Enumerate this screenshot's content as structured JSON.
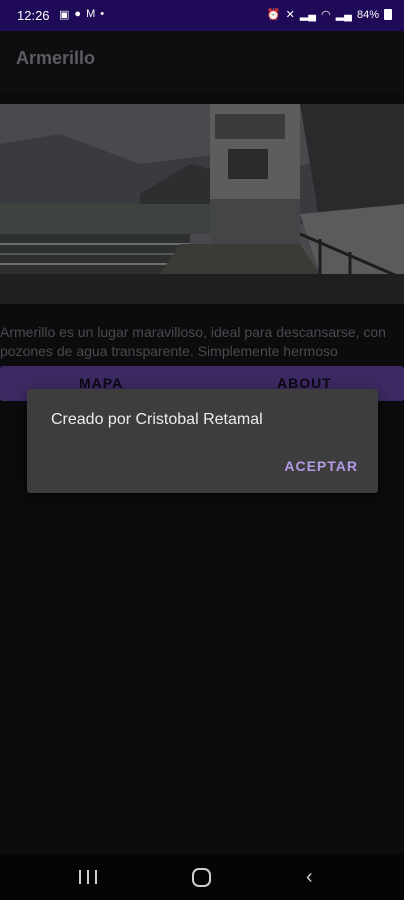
{
  "status_bar": {
    "time": "12:26",
    "left_icons": [
      "gallery-icon",
      "messenger-icon",
      "gmail-icon",
      "dot-icon"
    ],
    "battery": "84%"
  },
  "app_bar": {
    "title": "Armerillo"
  },
  "content": {
    "description": "Armerillo es un lugar maravilloso,  ideal para descansarse, con pozones de agua transparente. Simplemente hermoso"
  },
  "buttons": {
    "mapa": "MAPA",
    "about": "ABOUT"
  },
  "dialog": {
    "message": "Creado por Cristobal Retamal",
    "accept": "ACEPTAR"
  },
  "colors": {
    "status_bar": "#1e0a57",
    "button_row": "#3d2a63",
    "dialog": "#3d3d3d",
    "accent": "#b59be6"
  }
}
